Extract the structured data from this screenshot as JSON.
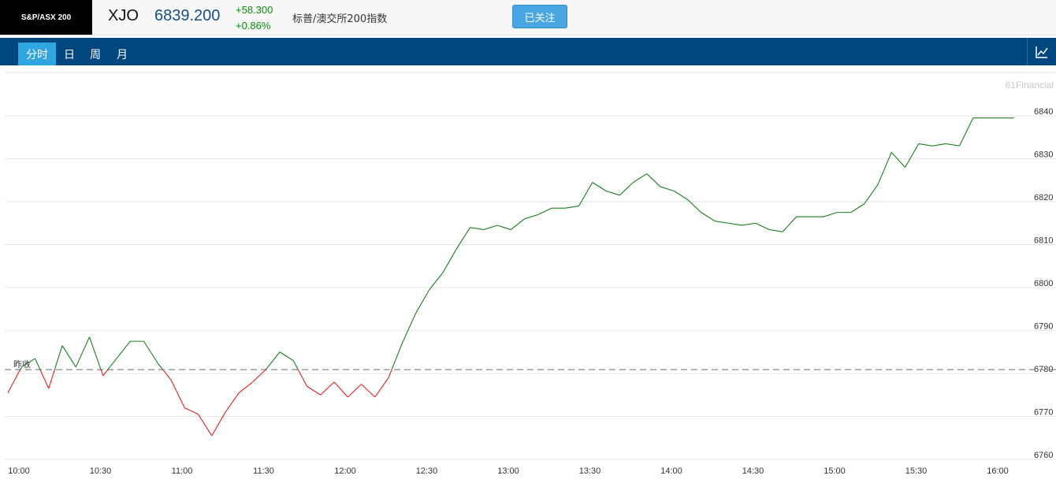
{
  "header": {
    "index_badge": "S&P/ASX 200",
    "symbol": "XJO",
    "price": "6839.200",
    "change": "+58.300",
    "change_pct": "+0.86%",
    "name": "标普/澳交所200指数",
    "follow_label": "已关注"
  },
  "tabs": [
    {
      "label": "分时",
      "active": true
    },
    {
      "label": "日",
      "active": false
    },
    {
      "label": "周",
      "active": false
    },
    {
      "label": "月",
      "active": false
    }
  ],
  "chart_icon": "line-chart-icon",
  "watermark": "61Financial",
  "colors": {
    "up": "#1e7d1e",
    "down": "#e02020",
    "grid": "#e6e6e6",
    "baseline": "#888888"
  },
  "chart_data": {
    "type": "line",
    "prev_close": 6780.9,
    "prev_close_label": "昨收",
    "ylim": [
      6760,
      6840
    ],
    "yticks": [
      6760,
      6770,
      6780,
      6790,
      6800,
      6810,
      6820,
      6830,
      6840
    ],
    "xticks": [
      "10:00",
      "10:30",
      "11:00",
      "11:30",
      "12:00",
      "12:30",
      "13:00",
      "13:30",
      "14:00",
      "14:30",
      "15:00",
      "15:30",
      "16:00"
    ],
    "x": [
      "10:00",
      "10:05",
      "10:10",
      "10:15",
      "10:20",
      "10:25",
      "10:30",
      "10:35",
      "10:40",
      "10:45",
      "10:50",
      "10:55",
      "11:00",
      "11:05",
      "11:10",
      "11:15",
      "11:20",
      "11:25",
      "11:30",
      "11:35",
      "11:40",
      "11:45",
      "11:50",
      "11:55",
      "12:00",
      "12:05",
      "12:10",
      "12:15",
      "12:20",
      "12:25",
      "12:30",
      "12:35",
      "12:40",
      "12:45",
      "12:50",
      "12:55",
      "13:00",
      "13:05",
      "13:10",
      "13:15",
      "13:20",
      "13:25",
      "13:30",
      "13:35",
      "13:40",
      "13:45",
      "13:50",
      "13:55",
      "14:00",
      "14:05",
      "14:10",
      "14:15",
      "14:20",
      "14:25",
      "14:30",
      "14:35",
      "14:40",
      "14:45",
      "14:50",
      "14:55",
      "15:00",
      "15:05",
      "15:10",
      "15:15",
      "15:20",
      "15:25",
      "15:30",
      "15:35",
      "15:40",
      "15:45",
      "15:50",
      "15:55",
      "16:00",
      "16:05",
      "16:10"
    ],
    "values": [
      6775.5,
      6781.5,
      6783.5,
      6776.5,
      6786.5,
      6781.5,
      6788.5,
      6779.5,
      6783.5,
      6787.5,
      6787.5,
      6782.5,
      6778.5,
      6772.0,
      6770.5,
      6765.5,
      6771.0,
      6775.5,
      6778.0,
      6781.0,
      6785.0,
      6783.0,
      6777.0,
      6775.0,
      6778.0,
      6774.5,
      6777.5,
      6774.5,
      6779.0,
      6787.0,
      6794.0,
      6799.5,
      6803.5,
      6809.0,
      6814.0,
      6813.5,
      6814.5,
      6813.5,
      6816.0,
      6817.0,
      6818.5,
      6818.5,
      6819.0,
      6824.5,
      6822.5,
      6821.5,
      6824.5,
      6826.5,
      6823.5,
      6822.5,
      6820.5,
      6817.5,
      6815.5,
      6815.0,
      6814.5,
      6815.0,
      6813.5,
      6813.0,
      6816.5,
      6816.5,
      6816.5,
      6817.5,
      6817.5,
      6819.5,
      6824.0,
      6831.5,
      6828.0,
      6833.5,
      6833.0,
      6833.5,
      6833.0,
      6839.5,
      6839.5,
      6839.5,
      6839.5
    ]
  }
}
